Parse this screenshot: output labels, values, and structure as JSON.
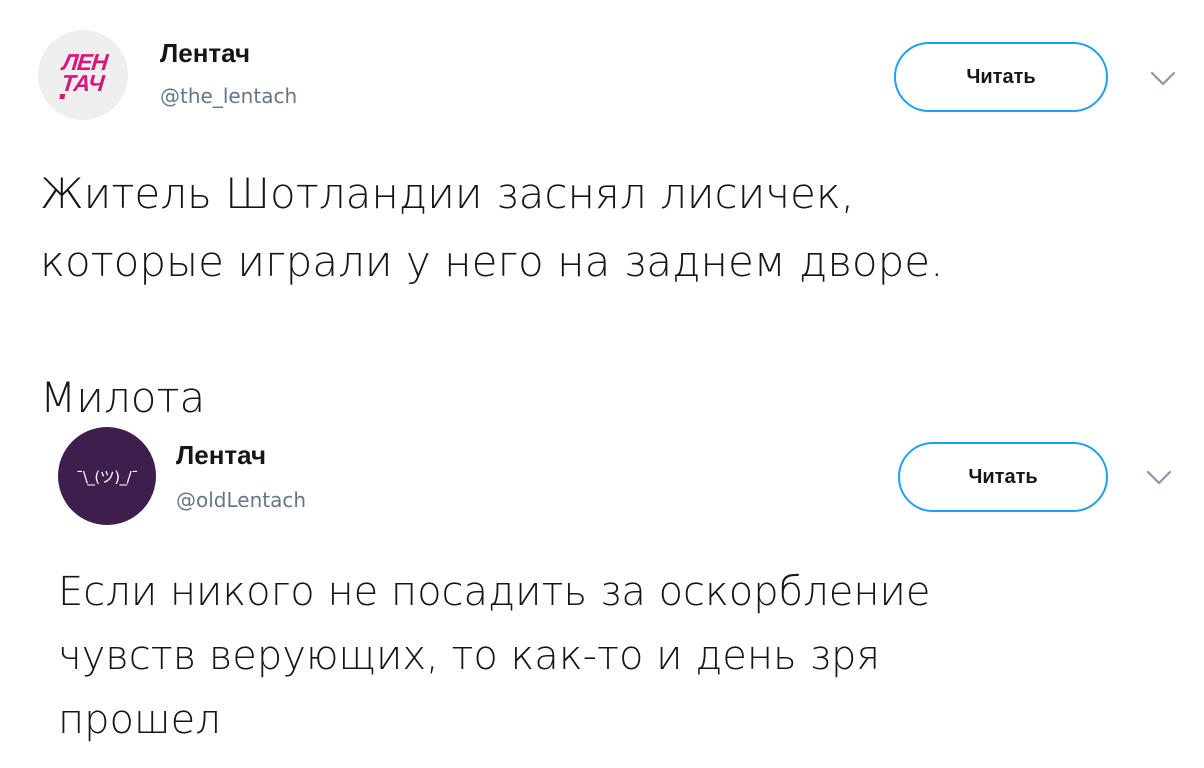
{
  "tweet1": {
    "avatar_logo": {
      "line1": "ЛЕН",
      "line2": "ТАЧ"
    },
    "name": "Лентач",
    "handle": "@the_lentach",
    "follow_label": "Читать",
    "text": "Житель Шотландии заснял лисичек,\nкоторые играли у него на заднем дворе.\n\nМилота"
  },
  "tweet2": {
    "avatar_glyph": "¯\\_(ツ)_/¯",
    "name": "Лентач",
    "handle": "@oldLentach",
    "follow_label": "Читать",
    "text": "Если никого не посадить за оскорбление\nчувств верующих, то как-то и день зря\nпрошел"
  },
  "colors": {
    "accent": "#1da1f2",
    "text": "#14171a",
    "secondary": "#657786",
    "logo_pink": "#d8177a",
    "avatar2_bg": "#3d1e4d"
  },
  "icons": [
    "chevron-down-icon"
  ]
}
